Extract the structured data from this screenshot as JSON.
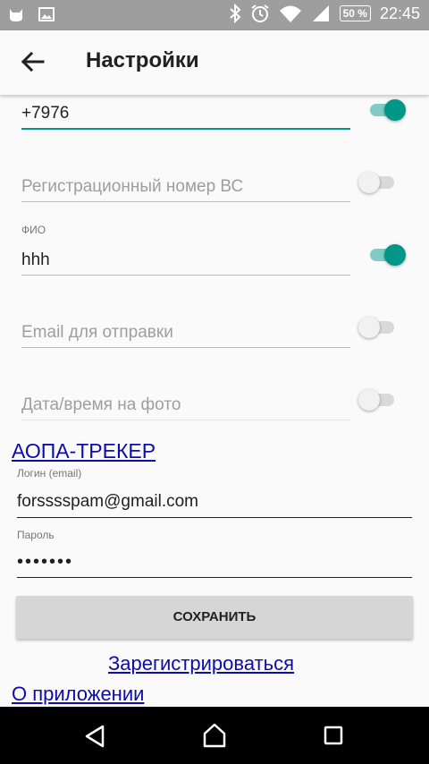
{
  "status_bar": {
    "battery": "50 %",
    "time": "22:45"
  },
  "app_bar": {
    "title": "Настройки"
  },
  "fields": {
    "phone": {
      "value": "+7976"
    },
    "reg_number": {
      "placeholder": "Регистрационный номер ВС"
    },
    "fio": {
      "label": "ФИО",
      "value": "hhh"
    },
    "email_send": {
      "placeholder": "Email для отправки"
    },
    "datetime_photo": {
      "placeholder": "Дата/время на фото"
    }
  },
  "toggles": {
    "phone": true,
    "reg_number": false,
    "fio": true,
    "email_send": false,
    "datetime_photo": false
  },
  "tracker": {
    "title": "АОПА-ТРЕКЕР",
    "login_label": "Логин (email)",
    "login_value": "forsssspam@gmail.com",
    "password_label": "Пароль",
    "password_value": "•••••••"
  },
  "buttons": {
    "save": "СОХРАНИТЬ"
  },
  "links": {
    "register": "Зарегистрироваться",
    "about": "О приложении"
  }
}
